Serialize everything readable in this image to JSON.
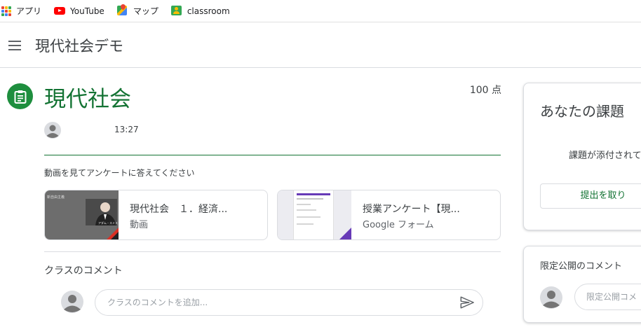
{
  "bookmarks": [
    {
      "label": "アプリ",
      "icon": "apps-grid-icon"
    },
    {
      "label": "YouTube",
      "icon": "youtube-icon"
    },
    {
      "label": "マップ",
      "icon": "maps-icon"
    },
    {
      "label": "classroom",
      "icon": "classroom-icon"
    }
  ],
  "appbar": {
    "title": "現代社会デモ"
  },
  "assignment": {
    "title": "現代社会",
    "points": "100 点",
    "time": "13:27",
    "instructions": "動画を見てアンケートに答えてください",
    "accent_color": "#137333"
  },
  "attachments": [
    {
      "title": "現代社会　１．経済...",
      "subtitle": "動画",
      "thumb_caption": "新自由主義",
      "thumb_caption_2": "アダム・スミス",
      "type": "video"
    },
    {
      "title": "授業アンケート【現...",
      "subtitle": "Google フォーム",
      "type": "form"
    }
  ],
  "comments": {
    "label": "クラスのコメント",
    "placeholder": "クラスのコメントを追加..."
  },
  "your_work": {
    "title": "あなたの課題",
    "note": "課題が添付されて",
    "button": "提出を取り"
  },
  "private_comments": {
    "title": "限定公開のコメント",
    "placeholder": "限定公開コメ"
  }
}
